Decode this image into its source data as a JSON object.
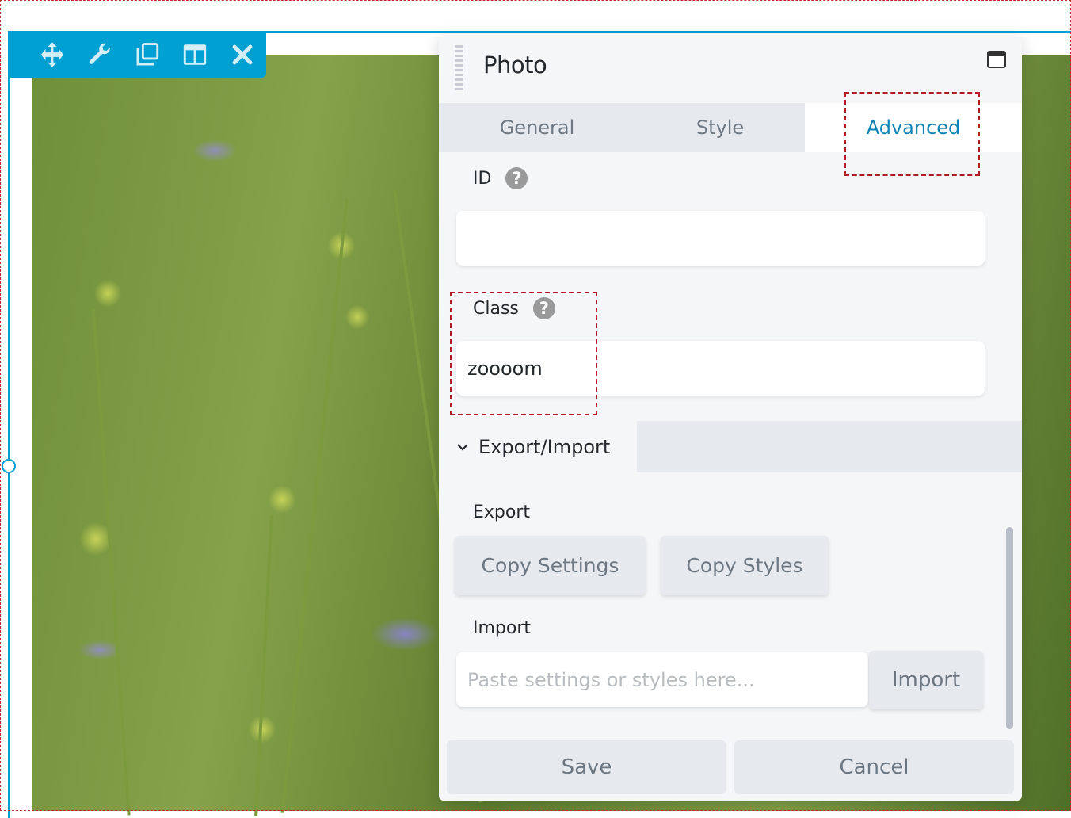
{
  "toolbar": {
    "buttons": [
      {
        "name": "move",
        "icon": "move-arrows-icon"
      },
      {
        "name": "settings",
        "icon": "wrench-icon"
      },
      {
        "name": "duplicate",
        "icon": "duplicate-icon"
      },
      {
        "name": "columns",
        "icon": "columns-icon"
      },
      {
        "name": "remove",
        "icon": "close-icon"
      }
    ],
    "accent_color": "#00a0d2"
  },
  "panel": {
    "title": "Photo",
    "tabs": [
      {
        "label": "General",
        "active": false
      },
      {
        "label": "Style",
        "active": false
      },
      {
        "label": "Advanced",
        "active": true
      }
    ],
    "active_tab_color": "#0e83b4",
    "fields": {
      "id": {
        "label": "ID",
        "value": "",
        "help": "?"
      },
      "class": {
        "label": "Class",
        "value": "zoooom",
        "help": "?"
      }
    },
    "export_import": {
      "section_title": "Export/Import",
      "export_label": "Export",
      "copy_settings_label": "Copy Settings",
      "copy_styles_label": "Copy Styles",
      "import_label": "Import",
      "import_placeholder": "Paste settings or styles here...",
      "import_button_label": "Import"
    },
    "footer": {
      "save_label": "Save",
      "cancel_label": "Cancel"
    }
  },
  "highlight_color": "#b01c23"
}
